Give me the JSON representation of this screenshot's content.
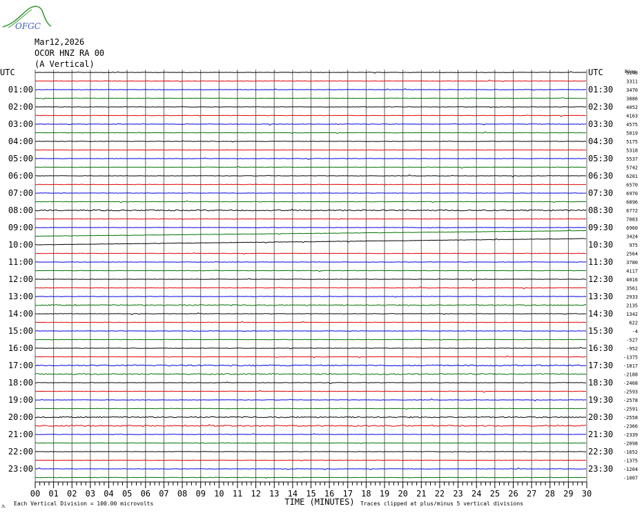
{
  "logo": {
    "text": "OFGC",
    "color_text": "#3b5bb3",
    "color_swoosh": "#3a9a3a"
  },
  "header": {
    "date": "Mar12,2026",
    "station": "OCOR HNZ RA 00",
    "component": "(A Vertical)"
  },
  "chart_data": {
    "type": "line",
    "title": "",
    "xlabel": "TIME (MINUTES)",
    "ylabel": "UTC",
    "left_axis_label": "UTC",
    "right_axis_label": "UTC",
    "right_top_label": "Bias",
    "x_ticks": [
      "00",
      "01",
      "02",
      "03",
      "04",
      "05",
      "06",
      "07",
      "08",
      "09",
      "10",
      "11",
      "12",
      "13",
      "14",
      "15",
      "16",
      "17",
      "18",
      "19",
      "20",
      "21",
      "22",
      "23",
      "24",
      "25",
      "26",
      "27",
      "28",
      "29",
      "30"
    ],
    "xlim": [
      0,
      30
    ],
    "grid": true,
    "trace_colors": [
      "#000000",
      "#e00000",
      "#0000e0",
      "#007000"
    ],
    "grid_color": "#606060",
    "left_labels": [
      "UTC",
      "01:00",
      "02:00",
      "03:00",
      "04:00",
      "05:00",
      "06:00",
      "07:00",
      "08:00",
      "09:00",
      "10:00",
      "11:00",
      "12:00",
      "13:00",
      "14:00",
      "15:00",
      "16:00",
      "17:00",
      "18:00",
      "19:00",
      "20:00",
      "21:00",
      "22:00",
      "23:00"
    ],
    "right_labels": [
      "UTC",
      "01:30",
      "02:30",
      "03:30",
      "04:30",
      "05:30",
      "06:30",
      "07:30",
      "08:30",
      "09:30",
      "10:30",
      "11:30",
      "12:30",
      "13:30",
      "14:30",
      "15:30",
      "16:30",
      "17:30",
      "18:30",
      "19:30",
      "20:30",
      "21:30",
      "22:30",
      "23:30"
    ],
    "bias_values": [
      "3148",
      "3311",
      "3470",
      "3886",
      "4052",
      "4163",
      "4575",
      "5019",
      "5175",
      "5318",
      "5537",
      "5742",
      "6201",
      "6570",
      "6970",
      "6896",
      "6772",
      "7083",
      "6960",
      "3424",
      "975",
      "2564",
      "3780",
      "4117",
      "4016",
      "3561",
      "2933",
      "2135",
      "1342",
      "622",
      "-4",
      "-527",
      "-952",
      "-1375",
      "-1817",
      "-2188",
      "-2468",
      "-2593",
      "-2578",
      "-2591",
      "-2558",
      "-2366",
      "-2339",
      "-2098",
      "-1652",
      "-1375",
      "-1204",
      "-1007"
    ],
    "footer_left": "Each Vertical Division =  100.00 microvolts",
    "footer_right": "Traces clipped at plus/minus 5 vertical divisions",
    "footer_corner": "JL"
  }
}
